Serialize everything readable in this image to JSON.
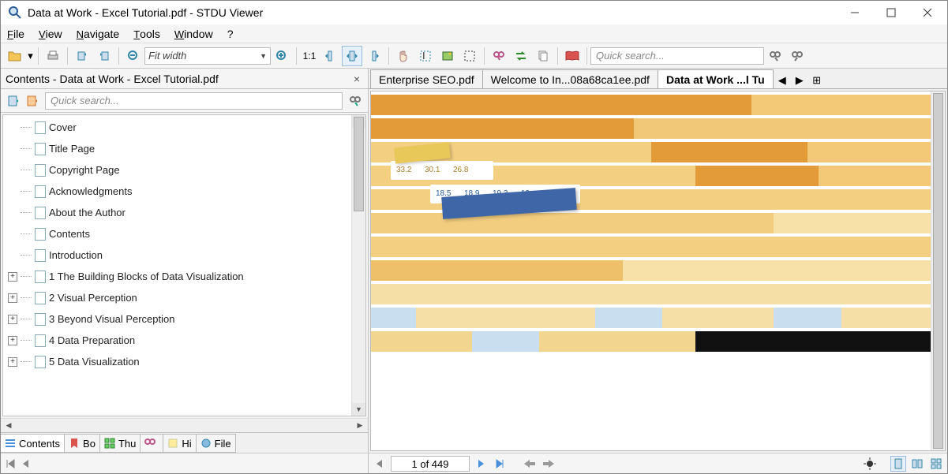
{
  "window": {
    "title": "Data at Work - Excel Tutorial.pdf - STDU Viewer"
  },
  "menu": {
    "file": "File",
    "view": "View",
    "navigate": "Navigate",
    "tools": "Tools",
    "window": "Window",
    "help": "?"
  },
  "toolbar": {
    "zoom_mode": "Fit width",
    "zoom_ratio": "1:1",
    "search_placeholder": "Quick search..."
  },
  "sidebar": {
    "title": "Contents - Data at Work - Excel Tutorial.pdf",
    "search_placeholder": "Quick search...",
    "items": [
      {
        "label": "Cover",
        "expandable": false
      },
      {
        "label": "Title Page",
        "expandable": false
      },
      {
        "label": "Copyright Page",
        "expandable": false
      },
      {
        "label": "Acknowledgments",
        "expandable": false
      },
      {
        "label": "About the Author",
        "expandable": false
      },
      {
        "label": "Contents",
        "expandable": false
      },
      {
        "label": "Introduction",
        "expandable": false
      },
      {
        "label": "1 The Building Blocks of Data Visualization",
        "expandable": true
      },
      {
        "label": "2 Visual Perception",
        "expandable": true
      },
      {
        "label": "3 Beyond Visual Perception",
        "expandable": true
      },
      {
        "label": "4 Data Preparation",
        "expandable": true
      },
      {
        "label": "5 Data Visualization",
        "expandable": true
      }
    ],
    "tabs": [
      {
        "label": "Contents",
        "active": true,
        "icon": "list"
      },
      {
        "label": "Bo",
        "active": false,
        "icon": "bookmark"
      },
      {
        "label": "Thu",
        "active": false,
        "icon": "thumb"
      },
      {
        "label": "",
        "active": false,
        "icon": "search"
      },
      {
        "label": "Hi",
        "active": false,
        "icon": "highlight"
      },
      {
        "label": "File",
        "active": false,
        "icon": "file"
      }
    ]
  },
  "doc_tabs": [
    {
      "label": "Enterprise SEO.pdf",
      "active": false
    },
    {
      "label": "Welcome to In...08a68ca1ee.pdf",
      "active": false
    },
    {
      "label": "Data at Work ...l Tu",
      "active": true
    }
  ],
  "pager": {
    "current": "1 of 449"
  },
  "chart_labels": {
    "row1": [
      "33.2",
      "30.1",
      "26.8"
    ],
    "row2": [
      "18.5",
      "18.9",
      "19.3",
      "19",
      "19.5"
    ]
  },
  "chart_data": {
    "type": "bar",
    "note": "Preview of stacked/horizontal bar chart from book cover; approximate widths as percent of page width and colors only.",
    "rows": [
      {
        "segments": [
          {
            "w": 68,
            "c": "#e39a39"
          },
          {
            "w": 32,
            "c": "#f3c978"
          }
        ]
      },
      {
        "segments": [
          {
            "w": 47,
            "c": "#e39a39"
          },
          {
            "w": 53,
            "c": "#f1c877"
          }
        ]
      },
      {
        "segments": [
          {
            "w": 50,
            "c": "#f3cf82"
          },
          {
            "w": 28,
            "c": "#e39a39"
          },
          {
            "w": 22,
            "c": "#f3c978"
          }
        ]
      },
      {
        "segments": [
          {
            "w": 58,
            "c": "#f3cf82"
          },
          {
            "w": 22,
            "c": "#e39a39"
          },
          {
            "w": 20,
            "c": "#f3c978"
          }
        ]
      },
      {
        "segments": [
          {
            "w": 100,
            "c": "#f3cf82"
          }
        ]
      },
      {
        "segments": [
          {
            "w": 72,
            "c": "#f2cd7f"
          },
          {
            "w": 28,
            "c": "#f7e1a9"
          }
        ]
      },
      {
        "segments": [
          {
            "w": 100,
            "c": "#f3cf82"
          }
        ]
      },
      {
        "segments": [
          {
            "w": 45,
            "c": "#eec06a"
          },
          {
            "w": 55,
            "c": "#f7e1a9"
          }
        ]
      },
      {
        "segments": [
          {
            "w": 100,
            "c": "#f6dfa6"
          }
        ]
      },
      {
        "segments": [
          {
            "w": 8,
            "c": "#c9dff0"
          },
          {
            "w": 32,
            "c": "#f6dfa6"
          },
          {
            "w": 12,
            "c": "#c9dff0"
          },
          {
            "w": 20,
            "c": "#f6dfa6"
          },
          {
            "w": 12,
            "c": "#c9dff0"
          },
          {
            "w": 16,
            "c": "#f6dfa6"
          }
        ]
      },
      {
        "segments": [
          {
            "w": 18,
            "c": "#f2d58f"
          },
          {
            "w": 12,
            "c": "#c9dff0"
          },
          {
            "w": 28,
            "c": "#f2d58f"
          },
          {
            "w": 42,
            "c": "#111"
          }
        ]
      }
    ]
  }
}
